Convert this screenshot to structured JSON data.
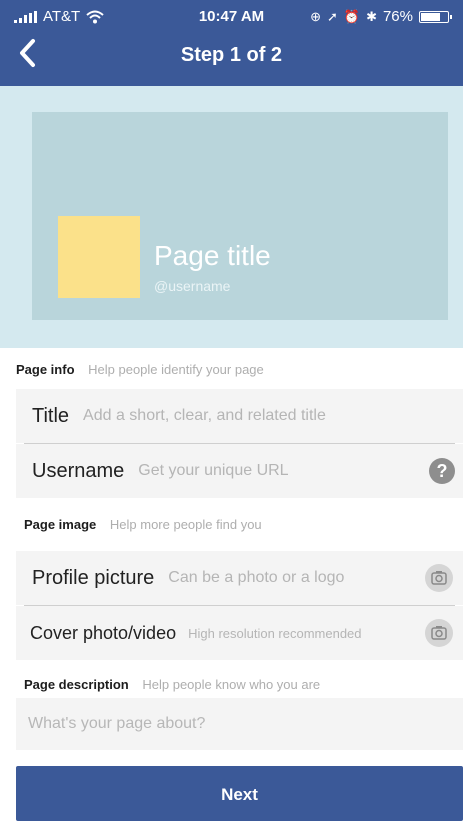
{
  "status_bar": {
    "carrier": "AT&T",
    "time": "10:47 AM",
    "battery": "76%",
    "battery_level": 0.76
  },
  "nav": {
    "back_icon": "chevron-left-icon",
    "title": "Step 1 of 2"
  },
  "preview": {
    "page_title": "Page title",
    "username": "@username"
  },
  "page_info": {
    "label": "Page info",
    "hint": "Help people identify your page",
    "title_label": "Title",
    "title_placeholder": "Add a short, clear, and related title",
    "username_label": "Username",
    "username_placeholder": "Get your unique URL",
    "help_icon": "?"
  },
  "page_image": {
    "label": "Page image",
    "hint": "Help more people find you",
    "profile_label": "Profile picture",
    "profile_hint": "Can be a photo or a logo",
    "cover_label": "Cover photo/video",
    "cover_hint": "High resolution recommended"
  },
  "page_description": {
    "label": "Page description",
    "hint": "Help people know who you are",
    "placeholder": "What's your page about?"
  },
  "next_label": "Next",
  "colors": {
    "brand": "#3b5998",
    "preview_bg": "#d4e9ef",
    "cover_bg": "#b9d5db",
    "thumb": "#fbe18a"
  }
}
